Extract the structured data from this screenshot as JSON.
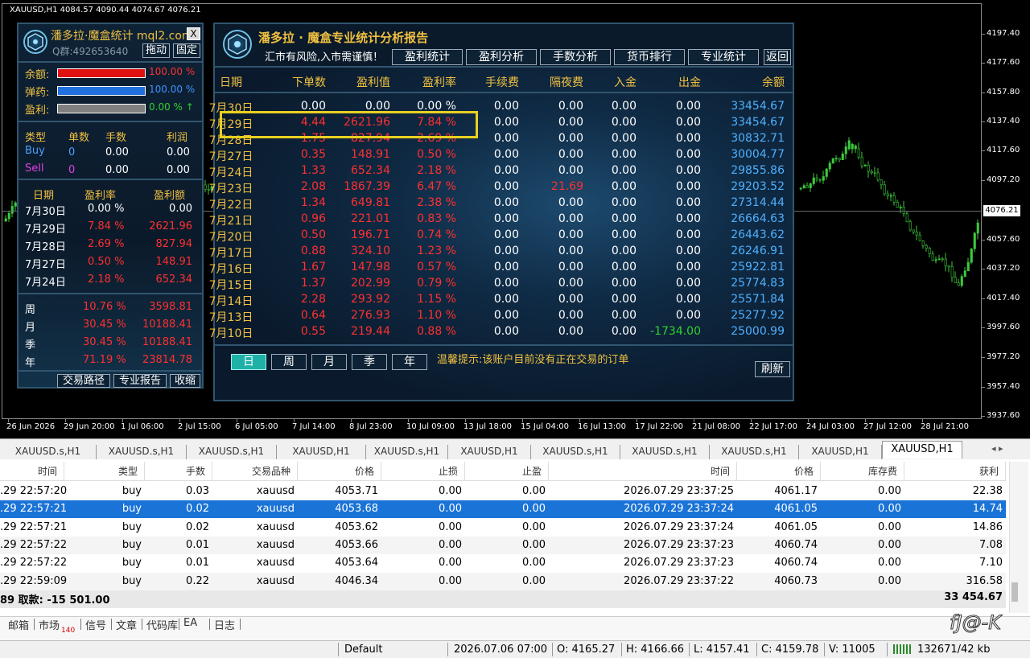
{
  "chart": {
    "header": "XAUUSD,H1  4084.57 4090.44 4074.67 4076.21",
    "price_now": "4076.21",
    "y_axis": [
      "4197.40",
      "4177.60",
      "4157.80",
      "4137.40",
      "4117.60",
      "4097.20",
      "4057.60",
      "4037.20",
      "4017.40",
      "3997.60",
      "3977.20",
      "3957.40",
      "3937.60"
    ],
    "x_axis": [
      "26 Jun 2026",
      "29 Jun 20:00",
      "1 Jul 06:00",
      "2 Jul 15:00",
      "6 Jul 05:00",
      "7 Jul 14:00",
      "8 Jul 23:00",
      "10 Jul 09:00",
      "13 Jul 18:00",
      "15 Jul 04:00",
      "16 Jul 13:00",
      "17 Jul 22:00",
      "21 Jul 08:00",
      "22 Jul 17:00",
      "24 Jul 03:00",
      "27 Jul 12:00",
      "28 Jul 21:00"
    ],
    "candle_color": "#3ec83e"
  },
  "left_panel": {
    "title": "潘多拉·魔盒统计 mql2.com",
    "close": "X",
    "qq": "Q群:492653640",
    "drag_btn": "拖动",
    "pin_btn": "固定",
    "bars": [
      {
        "label": "余额:",
        "value": "100.00 %",
        "color": "#e01010",
        "fill": 1.0
      },
      {
        "label": "弹药:",
        "value": "100.00 %",
        "color": "#2070e0",
        "fill": 1.0
      },
      {
        "label": "盈利:",
        "value": "0.00 % ↑",
        "color": "#808080",
        "fill": 1.0
      }
    ],
    "orders_header": [
      "类型",
      "单数",
      "手数",
      "利润"
    ],
    "orders": [
      {
        "type": "Buy",
        "count": "0",
        "lots": "0.00",
        "profit": "0.00"
      },
      {
        "type": "Sell",
        "count": "0",
        "lots": "0.00",
        "profit": "0.00"
      }
    ],
    "daily_header": [
      "日期",
      "盈利率",
      "盈利额"
    ],
    "daily": [
      {
        "date": "7月30日",
        "rate": "0.00 %",
        "amount": "0.00"
      },
      {
        "date": "7月29日",
        "rate": "7.84 %",
        "amount": "2621.96"
      },
      {
        "date": "7月28日",
        "rate": "2.69 %",
        "amount": "827.94"
      },
      {
        "date": "7月27日",
        "rate": "0.50 %",
        "amount": "148.91"
      },
      {
        "date": "7月24日",
        "rate": "2.18 %",
        "amount": "652.34"
      }
    ],
    "period": [
      {
        "label": "周",
        "rate": "10.76 %",
        "amount": "3598.81"
      },
      {
        "label": "月",
        "rate": "30.45 %",
        "amount": "10188.41"
      },
      {
        "label": "季",
        "rate": "30.45 %",
        "amount": "10188.41"
      },
      {
        "label": "年",
        "rate": "71.19 %",
        "amount": "23814.78"
      }
    ],
    "footer_btns": [
      "交易路径",
      "专业报告",
      "收缩"
    ]
  },
  "report": {
    "title": "潘多拉 · 魔盒专业统计分析报告",
    "subtitle": "汇市有风险,入市需谨慎！",
    "tabs": [
      "盈利统计",
      "盈利分析",
      "手数分析",
      "货币排行",
      "专业统计"
    ],
    "back": "返回",
    "columns": [
      "日期",
      "下单数",
      "盈利值",
      "盈利率",
      "手续费",
      "隔夜费",
      "入金",
      "出金",
      "余额"
    ],
    "rows": [
      [
        "7月30日",
        "0.00",
        "0.00",
        "0.00 %",
        "0.00",
        "0.00",
        "0.00",
        "0.00",
        "33454.67"
      ],
      [
        "7月29日",
        "4.44",
        "2621.96",
        "7.84 %",
        "0.00",
        "0.00",
        "0.00",
        "0.00",
        "33454.67"
      ],
      [
        "7月28日",
        "1.75",
        "827.94",
        "2.69 %",
        "0.00",
        "0.00",
        "0.00",
        "0.00",
        "30832.71"
      ],
      [
        "7月27日",
        "0.35",
        "148.91",
        "0.50 %",
        "0.00",
        "0.00",
        "0.00",
        "0.00",
        "30004.77"
      ],
      [
        "7月24日",
        "1.33",
        "652.34",
        "2.18 %",
        "0.00",
        "0.00",
        "0.00",
        "0.00",
        "29855.86"
      ],
      [
        "7月23日",
        "2.08",
        "1867.39",
        "6.47 %",
        "0.00",
        "21.69",
        "0.00",
        "0.00",
        "29203.52"
      ],
      [
        "7月22日",
        "1.34",
        "649.81",
        "2.38 %",
        "0.00",
        "0.00",
        "0.00",
        "0.00",
        "27314.44"
      ],
      [
        "7月21日",
        "0.96",
        "221.01",
        "0.83 %",
        "0.00",
        "0.00",
        "0.00",
        "0.00",
        "26664.63"
      ],
      [
        "7月20日",
        "0.50",
        "196.71",
        "0.74 %",
        "0.00",
        "0.00",
        "0.00",
        "0.00",
        "26443.62"
      ],
      [
        "7月17日",
        "0.88",
        "324.10",
        "1.23 %",
        "0.00",
        "0.00",
        "0.00",
        "0.00",
        "26246.91"
      ],
      [
        "7月16日",
        "1.67",
        "147.98",
        "0.57 %",
        "0.00",
        "0.00",
        "0.00",
        "0.00",
        "25922.81"
      ],
      [
        "7月15日",
        "1.37",
        "202.99",
        "0.79 %",
        "0.00",
        "0.00",
        "0.00",
        "0.00",
        "25774.83"
      ],
      [
        "7月14日",
        "2.28",
        "293.92",
        "1.15 %",
        "0.00",
        "0.00",
        "0.00",
        "0.00",
        "25571.84"
      ],
      [
        "7月13日",
        "0.64",
        "276.93",
        "1.10 %",
        "0.00",
        "0.00",
        "0.00",
        "0.00",
        "25277.92"
      ],
      [
        "7月10日",
        "0.55",
        "219.44",
        "0.88 %",
        "0.00",
        "0.00",
        "0.00",
        "-1734.00",
        "25000.99"
      ]
    ],
    "period_btns": [
      "日",
      "周",
      "月",
      "季",
      "年"
    ],
    "hint": "温馨提示:该账户目前没有正在交易的订单",
    "refresh": "刷新"
  },
  "tabs": [
    "XAUUSD.s,H1",
    "XAUUSD.s,H1",
    "XAUUSD.s,H1",
    "XAUUSD,H1",
    "XAUUSD.s,H1",
    "XAUUSD,H1",
    "XAUUSD.s,H1",
    "XAUUSD.s,H1",
    "XAUUSD.s,H1",
    "XAUUSD,H1",
    "XAUUSD,H1"
  ],
  "tab_nav": "◂ ▸",
  "table": {
    "headers": [
      "时间",
      "类型",
      "手数",
      "交易品种",
      "价格",
      "止损",
      "止盈",
      "时间",
      "价格",
      "库存费",
      "获利"
    ],
    "sort_mark": "/",
    "rows": [
      [
        ".29 22:57:20",
        "buy",
        "0.03",
        "xauusd",
        "4053.71",
        "0.00",
        "0.00",
        "2026.07.29 23:37:25",
        "4061.17",
        "0.00",
        "22.38"
      ],
      [
        ".29 22:57:21",
        "buy",
        "0.02",
        "xauusd",
        "4053.68",
        "0.00",
        "0.00",
        "2026.07.29 23:37:24",
        "4061.05",
        "0.00",
        "14.74"
      ],
      [
        ".29 22:57:21",
        "buy",
        "0.02",
        "xauusd",
        "4053.62",
        "0.00",
        "0.00",
        "2026.07.29 23:37:24",
        "4061.05",
        "0.00",
        "14.86"
      ],
      [
        ".29 22:57:22",
        "buy",
        "0.01",
        "xauusd",
        "4053.66",
        "0.00",
        "0.00",
        "2026.07.29 23:37:23",
        "4060.74",
        "0.00",
        "7.08"
      ],
      [
        ".29 22:57:22",
        "buy",
        "0.01",
        "xauusd",
        "4053.64",
        "0.00",
        "0.00",
        "2026.07.29 23:37:23",
        "4060.74",
        "0.00",
        "7.10"
      ],
      [
        ".29 22:59:09",
        "buy",
        "0.22",
        "xauusd",
        "4046.34",
        "0.00",
        "0.00",
        "2026.07.29 23:37:22",
        "4060.73",
        "0.00",
        "316.58"
      ]
    ],
    "summary_left": "89  取款: -15 501.00",
    "summary_right": "33 454.67"
  },
  "bottom_tabs": [
    {
      "label": "邮箱"
    },
    {
      "label": "市场",
      "badge": "140"
    },
    {
      "label": "信号"
    },
    {
      "label": "文章"
    },
    {
      "label": "代码库"
    },
    {
      "label": "EA"
    },
    {
      "label": "日志"
    }
  ],
  "watermark": "fJ@-K",
  "status": {
    "profile": "Default",
    "datetime": "2026.07.06 07:00",
    "open": "O: 4165.27",
    "high": "H: 4166.66",
    "low": "L: 4157.41",
    "close": "C: 4159.78",
    "volume": "V: 11005",
    "traffic": "132671/42 kb"
  }
}
